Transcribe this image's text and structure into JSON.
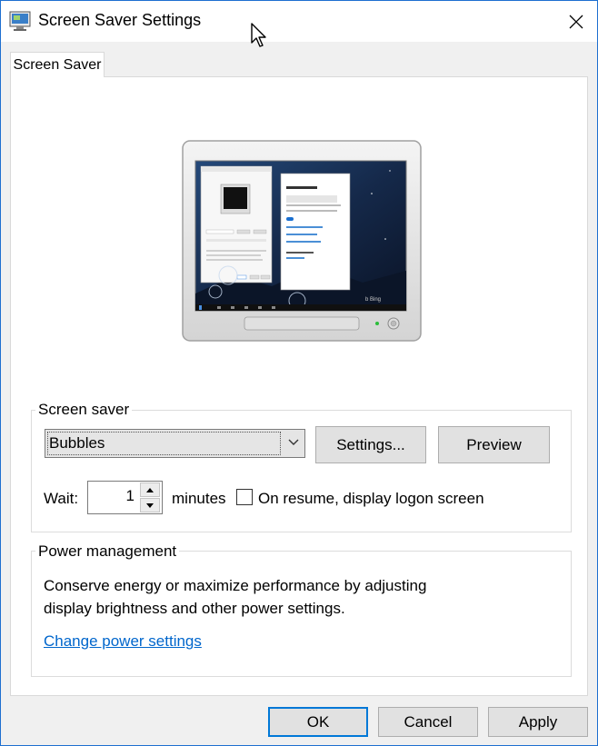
{
  "window": {
    "title": "Screen Saver Settings",
    "close_glyph": "✕",
    "border_color": "#1e6fd0"
  },
  "tabs": [
    {
      "label": "Screen Saver",
      "selected": true
    }
  ],
  "screen_saver_group": {
    "label": "Screen saver",
    "selected_saver": "Bubbles",
    "settings_button": "Settings...",
    "preview_button": "Preview",
    "wait_label": "Wait:",
    "wait_value": "1",
    "minutes_label": "minutes",
    "on_resume_label": "On resume, display logon screen",
    "on_resume_checked": false
  },
  "power_group": {
    "label": "Power management",
    "description_line1": "Conserve energy or maximize performance by adjusting",
    "description_line2": "display brightness and other power settings.",
    "link": "Change power settings"
  },
  "footer": {
    "ok_button": "OK",
    "cancel_button": "Cancel",
    "apply_button": "Apply"
  },
  "colors": {
    "accent": "#0078d7",
    "link": "#0066cc",
    "preview_desktop": "#1a2f4f"
  },
  "icons": {
    "title_icon": "screen-saver-monitor-icon",
    "close_icon": "close-icon",
    "combo_arrow": "chevron-down-icon",
    "spin_up": "spin-up-icon",
    "spin_down": "spin-down-icon",
    "cursor": "mouse-pointer-icon"
  }
}
